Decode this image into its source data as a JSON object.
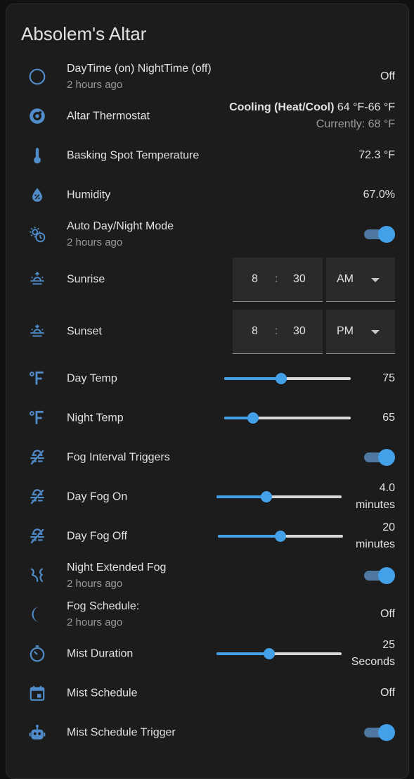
{
  "card": {
    "title": "Absolem's Altar"
  },
  "colors": {
    "icon": "#4f8cc9",
    "accent": "#43a1ea",
    "toggle_track": "#4f78a0",
    "card_bg": "#1c1c1c",
    "text": "#e1e1e1",
    "secondary": "#9b9b9b"
  },
  "rows": {
    "daytime": {
      "icon": "circle-outline-icon",
      "name": "DayTime (on) NightTime (off)",
      "sub": "2 hours ago",
      "state": "Off"
    },
    "thermostat": {
      "icon": "thermostat-icon",
      "name": "Altar Thermostat",
      "mode": "Cooling (Heat/Cool)",
      "range": "64 °F-66 °F",
      "current": "Currently: 68 °F"
    },
    "basking": {
      "icon": "thermometer-icon",
      "name": "Basking Spot Temperature",
      "state": "72.3 °F"
    },
    "humidity": {
      "icon": "water-percent-icon",
      "name": "Humidity",
      "state": "67.0%"
    },
    "auto_mode": {
      "icon": "timer-sun-icon",
      "name": "Auto Day/Night Mode",
      "sub": "2 hours ago",
      "on": true
    },
    "sunrise": {
      "icon": "sunrise-icon",
      "name": "Sunrise",
      "hour": "8",
      "sep": ":",
      "minute": "30",
      "ampm": "AM"
    },
    "sunset": {
      "icon": "sunset-icon",
      "name": "Sunset",
      "hour": "8",
      "sep": ":",
      "minute": "30",
      "ampm": "PM"
    },
    "day_temp": {
      "icon": "fahrenheit-icon",
      "name": "Day Temp",
      "value": "75",
      "level": 0.45
    },
    "night_temp": {
      "icon": "fahrenheit-icon",
      "name": "Night Temp",
      "value": "65",
      "level": 0.23
    },
    "fog_triggers": {
      "icon": "weather-fog-off-icon",
      "name": "Fog Interval Triggers",
      "on": true
    },
    "day_fog_on": {
      "icon": "weather-fog-off-icon",
      "name": "Day Fog On",
      "value": "4.0",
      "unit": "minutes",
      "level": 0.4
    },
    "day_fog_off": {
      "icon": "weather-fog-off-icon",
      "name": "Day Fog Off",
      "value": "20",
      "unit": "minutes",
      "level": 0.5
    },
    "night_fog": {
      "icon": "weather-windy-icon",
      "name": "Night Extended Fog",
      "sub": "2 hours ago",
      "on": true
    },
    "fog_schedule": {
      "icon": "moon-icon",
      "name": "Fog Schedule:",
      "sub": "2 hours ago",
      "state": "Off"
    },
    "mist_duration": {
      "icon": "timer-icon",
      "name": "Mist Duration",
      "value": "25",
      "unit": "Seconds",
      "level": 0.42
    },
    "mist_schedule": {
      "icon": "calendar-icon",
      "name": "Mist Schedule",
      "state": "Off"
    },
    "mist_trigger": {
      "icon": "robot-icon",
      "name": "Mist Schedule Trigger",
      "on": true
    }
  }
}
